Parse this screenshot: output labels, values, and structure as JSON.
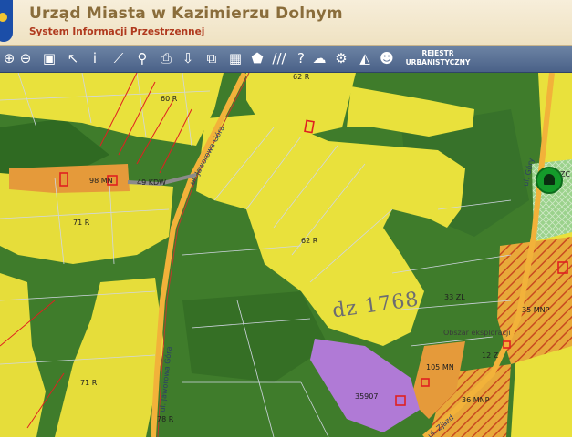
{
  "header": {
    "title": "Urząd Miasta w Kazimierzu Dolnym",
    "subtitle": "System Informacji Przestrzennej"
  },
  "toolbar": {
    "tools": [
      {
        "name": "zoom-in-icon",
        "glyph": "⊕"
      },
      {
        "name": "zoom-out-icon",
        "glyph": "⊖"
      },
      {
        "name": "zoom-extent-icon",
        "glyph": "▣"
      },
      {
        "name": "pointer-icon",
        "glyph": "↖"
      },
      {
        "name": "info-icon",
        "glyph": "i"
      },
      {
        "name": "measure-icon",
        "glyph": "⟋"
      },
      {
        "name": "link-icon",
        "glyph": "⚲"
      },
      {
        "name": "print-icon",
        "glyph": "⎙"
      },
      {
        "name": "download-icon",
        "glyph": "⇩"
      },
      {
        "name": "layers-icon",
        "glyph": "⧉"
      },
      {
        "name": "layout-icon",
        "glyph": "▦"
      },
      {
        "name": "shape-icon",
        "glyph": "⬟"
      },
      {
        "name": "hatch-icon",
        "glyph": "///"
      },
      {
        "name": "help-icon",
        "glyph": "?"
      },
      {
        "name": "cloud-icon",
        "glyph": "☁"
      },
      {
        "name": "settings-icon",
        "glyph": "⚙"
      },
      {
        "name": "triangle-icon",
        "glyph": "◭"
      },
      {
        "name": "user-icon",
        "glyph": "☻"
      }
    ],
    "register": {
      "line1": "REJESTR",
      "line2": "URBANISTYCZNY"
    }
  },
  "map": {
    "labels": {
      "l60r": "60 R",
      "l62r_top": "62 R",
      "l98": "98 MN",
      "l49": "49 KDW",
      "l71r_a": "71 R",
      "l62r_mid": "62 R",
      "l33zl": "33 ZL",
      "l35mnp": "35 MNP",
      "l12z": "12 Z",
      "l105": "105 MN",
      "l35907": "35907",
      "l36mnp": "36 MNP",
      "l71r_b": "71 R",
      "l78r": "78 R",
      "lzc": "ZC",
      "obszar": "Obszar eksploracji"
    },
    "streets": {
      "s1": "ul. Jaworowa Góra",
      "s2": "ul. Jaworowa Góra",
      "s3": "ul. Góry",
      "s4": "ul. Zjazd"
    },
    "handwriting": "dz 1768",
    "colors": {
      "forest": "#3f7c2b",
      "agri": "#e9e13c",
      "residential": "#e59a3a",
      "purple": "#b07ad6",
      "parcel": "#d0d6e2",
      "road": "#f2b23a",
      "redline": "#e02020"
    }
  }
}
